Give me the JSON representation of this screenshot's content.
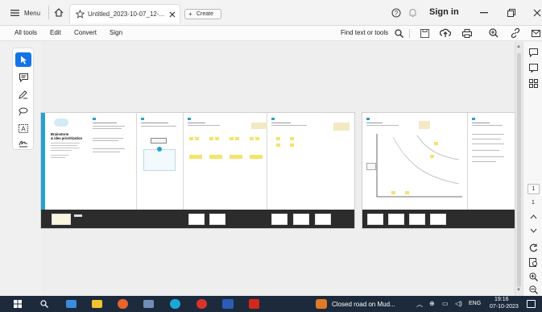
{
  "tabbar": {
    "menu_label": "Menu",
    "tab_title": "Untitled_2023-10-07_12-...",
    "create_label": "Create",
    "signin_label": "Sign in"
  },
  "menubar": {
    "items": [
      "All tools",
      "Edit",
      "Convert",
      "Sign"
    ],
    "find_label": "Find text or tools"
  },
  "board": {
    "title_line1": "Brainstorm",
    "title_line2": "& idea prioritization"
  },
  "right_rail": {
    "page_current": "1",
    "page_total": "1"
  },
  "taskbar": {
    "weather_text": "Closed road on Mud...",
    "lang": "ENG",
    "time": "19:16",
    "date": "07-10-2023"
  },
  "colors": {
    "accent_blue": "#1473e6",
    "note_yellow": "#f6e36a",
    "strip_dark": "#2c2c2c",
    "board_cyan": "#27a0cf",
    "taskbar": "#1c2a3c"
  }
}
